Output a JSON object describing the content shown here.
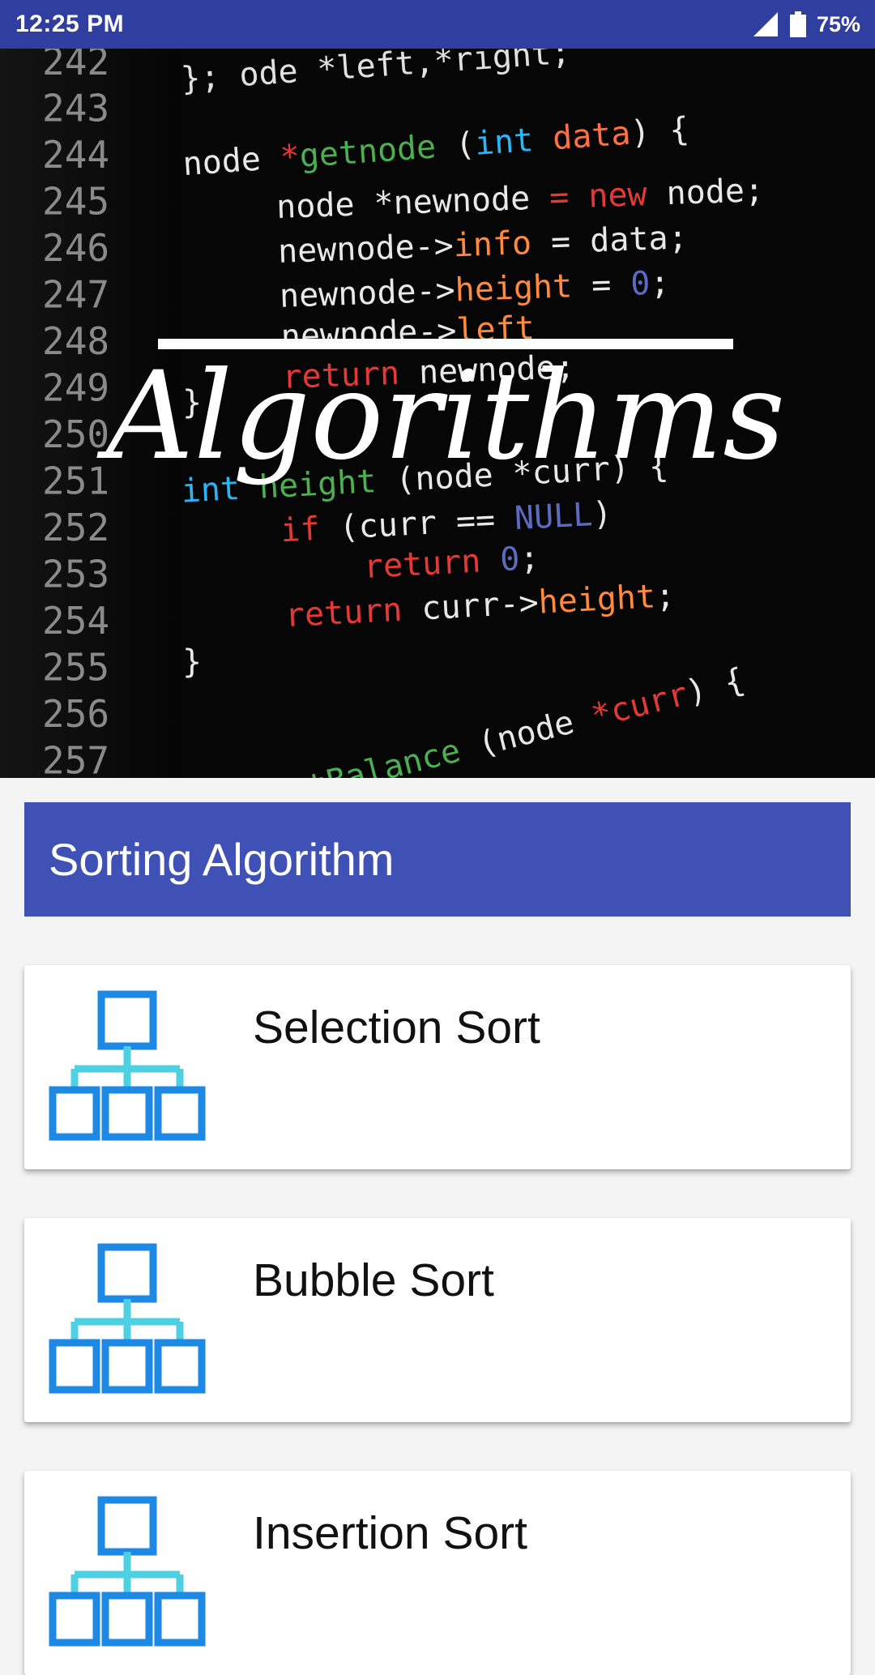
{
  "status_bar": {
    "time": "12:25 PM",
    "battery_percent": "75%",
    "signal_icon": "signal-icon",
    "battery_icon": "battery-icon"
  },
  "header": {
    "banner_title": "Algorithms",
    "line_numbers": [
      "242",
      "243",
      "244",
      "245",
      "246",
      "247",
      "248",
      "249",
      "250",
      "251",
      "252",
      "253",
      "254",
      "255",
      "256",
      "257"
    ]
  },
  "section": {
    "title": "Sorting Algorithm"
  },
  "list": {
    "items": [
      {
        "label": "Selection Sort",
        "icon": "hierarchy-icon"
      },
      {
        "label": "Bubble Sort",
        "icon": "hierarchy-icon"
      },
      {
        "label": "Insertion Sort",
        "icon": "hierarchy-icon"
      }
    ]
  },
  "colors": {
    "status_bar": "#303f9f",
    "section_header": "#3f51b5",
    "icon_primary": "#1e88e5",
    "icon_secondary": "#4dd0e1",
    "page_background": "#f4f4f4"
  }
}
